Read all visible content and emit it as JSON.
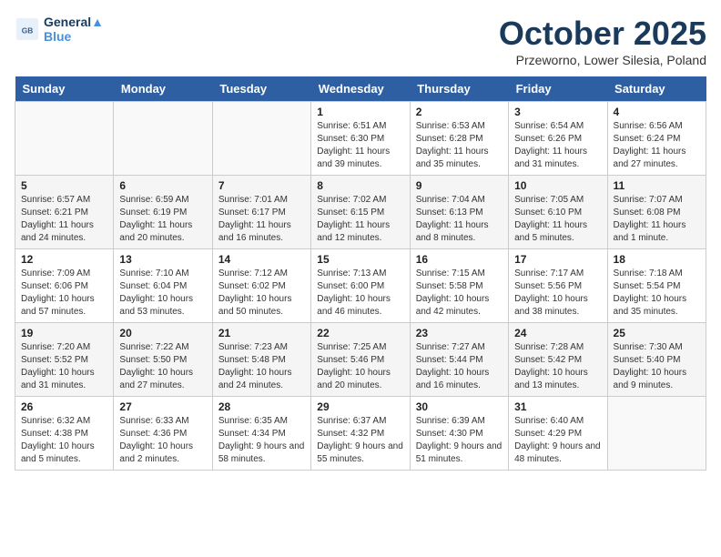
{
  "logo": {
    "line1": "General",
    "line2": "Blue"
  },
  "title": "October 2025",
  "subtitle": "Przeworno, Lower Silesia, Poland",
  "weekdays": [
    "Sunday",
    "Monday",
    "Tuesday",
    "Wednesday",
    "Thursday",
    "Friday",
    "Saturday"
  ],
  "weeks": [
    [
      {
        "day": "",
        "text": ""
      },
      {
        "day": "",
        "text": ""
      },
      {
        "day": "",
        "text": ""
      },
      {
        "day": "1",
        "text": "Sunrise: 6:51 AM\nSunset: 6:30 PM\nDaylight: 11 hours\nand 39 minutes."
      },
      {
        "day": "2",
        "text": "Sunrise: 6:53 AM\nSunset: 6:28 PM\nDaylight: 11 hours\nand 35 minutes."
      },
      {
        "day": "3",
        "text": "Sunrise: 6:54 AM\nSunset: 6:26 PM\nDaylight: 11 hours\nand 31 minutes."
      },
      {
        "day": "4",
        "text": "Sunrise: 6:56 AM\nSunset: 6:24 PM\nDaylight: 11 hours\nand 27 minutes."
      }
    ],
    [
      {
        "day": "5",
        "text": "Sunrise: 6:57 AM\nSunset: 6:21 PM\nDaylight: 11 hours\nand 24 minutes."
      },
      {
        "day": "6",
        "text": "Sunrise: 6:59 AM\nSunset: 6:19 PM\nDaylight: 11 hours\nand 20 minutes."
      },
      {
        "day": "7",
        "text": "Sunrise: 7:01 AM\nSunset: 6:17 PM\nDaylight: 11 hours\nand 16 minutes."
      },
      {
        "day": "8",
        "text": "Sunrise: 7:02 AM\nSunset: 6:15 PM\nDaylight: 11 hours\nand 12 minutes."
      },
      {
        "day": "9",
        "text": "Sunrise: 7:04 AM\nSunset: 6:13 PM\nDaylight: 11 hours\nand 8 minutes."
      },
      {
        "day": "10",
        "text": "Sunrise: 7:05 AM\nSunset: 6:10 PM\nDaylight: 11 hours\nand 5 minutes."
      },
      {
        "day": "11",
        "text": "Sunrise: 7:07 AM\nSunset: 6:08 PM\nDaylight: 11 hours\nand 1 minute."
      }
    ],
    [
      {
        "day": "12",
        "text": "Sunrise: 7:09 AM\nSunset: 6:06 PM\nDaylight: 10 hours\nand 57 minutes."
      },
      {
        "day": "13",
        "text": "Sunrise: 7:10 AM\nSunset: 6:04 PM\nDaylight: 10 hours\nand 53 minutes."
      },
      {
        "day": "14",
        "text": "Sunrise: 7:12 AM\nSunset: 6:02 PM\nDaylight: 10 hours\nand 50 minutes."
      },
      {
        "day": "15",
        "text": "Sunrise: 7:13 AM\nSunset: 6:00 PM\nDaylight: 10 hours\nand 46 minutes."
      },
      {
        "day": "16",
        "text": "Sunrise: 7:15 AM\nSunset: 5:58 PM\nDaylight: 10 hours\nand 42 minutes."
      },
      {
        "day": "17",
        "text": "Sunrise: 7:17 AM\nSunset: 5:56 PM\nDaylight: 10 hours\nand 38 minutes."
      },
      {
        "day": "18",
        "text": "Sunrise: 7:18 AM\nSunset: 5:54 PM\nDaylight: 10 hours\nand 35 minutes."
      }
    ],
    [
      {
        "day": "19",
        "text": "Sunrise: 7:20 AM\nSunset: 5:52 PM\nDaylight: 10 hours\nand 31 minutes."
      },
      {
        "day": "20",
        "text": "Sunrise: 7:22 AM\nSunset: 5:50 PM\nDaylight: 10 hours\nand 27 minutes."
      },
      {
        "day": "21",
        "text": "Sunrise: 7:23 AM\nSunset: 5:48 PM\nDaylight: 10 hours\nand 24 minutes."
      },
      {
        "day": "22",
        "text": "Sunrise: 7:25 AM\nSunset: 5:46 PM\nDaylight: 10 hours\nand 20 minutes."
      },
      {
        "day": "23",
        "text": "Sunrise: 7:27 AM\nSunset: 5:44 PM\nDaylight: 10 hours\nand 16 minutes."
      },
      {
        "day": "24",
        "text": "Sunrise: 7:28 AM\nSunset: 5:42 PM\nDaylight: 10 hours\nand 13 minutes."
      },
      {
        "day": "25",
        "text": "Sunrise: 7:30 AM\nSunset: 5:40 PM\nDaylight: 10 hours\nand 9 minutes."
      }
    ],
    [
      {
        "day": "26",
        "text": "Sunrise: 6:32 AM\nSunset: 4:38 PM\nDaylight: 10 hours\nand 5 minutes."
      },
      {
        "day": "27",
        "text": "Sunrise: 6:33 AM\nSunset: 4:36 PM\nDaylight: 10 hours\nand 2 minutes."
      },
      {
        "day": "28",
        "text": "Sunrise: 6:35 AM\nSunset: 4:34 PM\nDaylight: 9 hours\nand 58 minutes."
      },
      {
        "day": "29",
        "text": "Sunrise: 6:37 AM\nSunset: 4:32 PM\nDaylight: 9 hours\nand 55 minutes."
      },
      {
        "day": "30",
        "text": "Sunrise: 6:39 AM\nSunset: 4:30 PM\nDaylight: 9 hours\nand 51 minutes."
      },
      {
        "day": "31",
        "text": "Sunrise: 6:40 AM\nSunset: 4:29 PM\nDaylight: 9 hours\nand 48 minutes."
      },
      {
        "day": "",
        "text": ""
      }
    ]
  ]
}
